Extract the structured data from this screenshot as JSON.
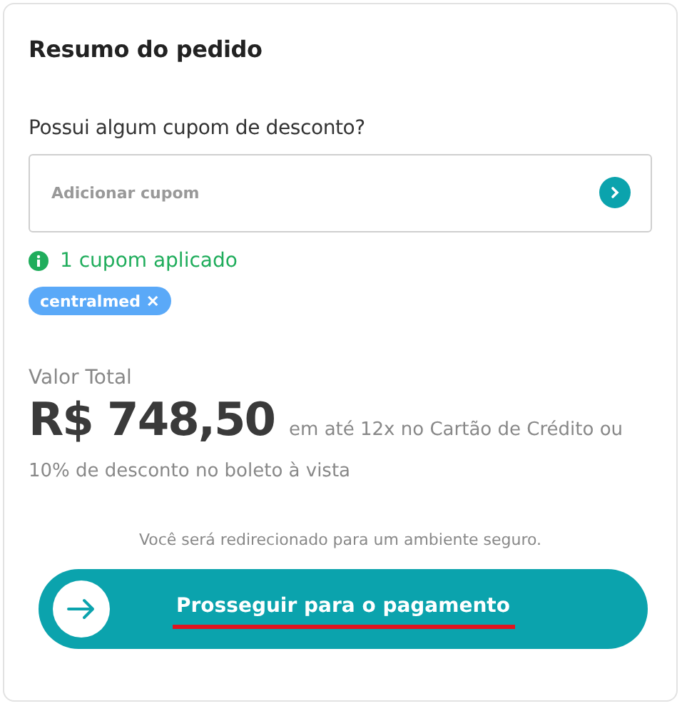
{
  "title": "Resumo do pedido",
  "coupon": {
    "question": "Possui algum cupom de desconto?",
    "placeholder": "Adicionar cupom",
    "status": "1 cupom aplicado",
    "applied": [
      {
        "code": "centralmed",
        "remove": "✕"
      }
    ]
  },
  "total": {
    "label": "Valor Total",
    "price": "R$ 748,50",
    "terms": [
      "em até 12x no Cartão de Crédito ou",
      "10% de desconto no boleto à vista"
    ]
  },
  "note": "Você será redirecionado para um ambiente seguro.",
  "button": {
    "label": "Prosseguir para o pagamento",
    "underlined": true
  }
}
